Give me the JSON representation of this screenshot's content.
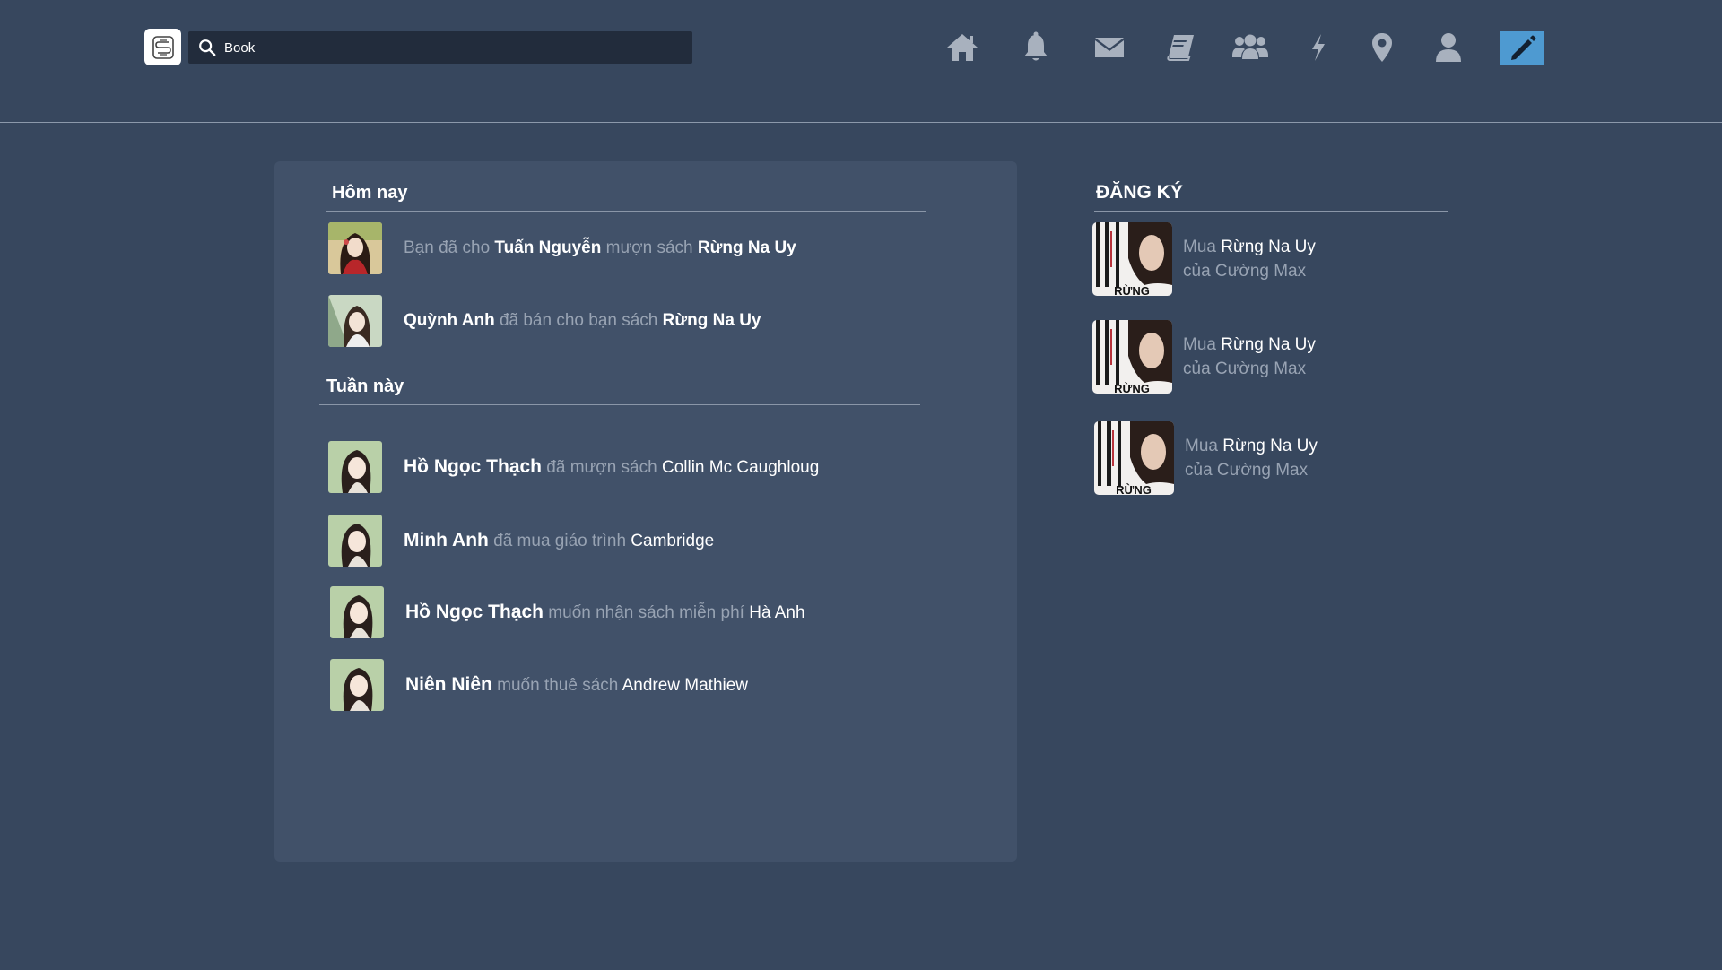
{
  "header": {
    "logo": "S",
    "search_value": "Book",
    "nav_icons": [
      "home-icon",
      "bell-icon",
      "mail-icon",
      "book-icon",
      "group-icon",
      "bolt-icon",
      "location-icon",
      "user-icon",
      "pencil-icon"
    ],
    "active_color": "#4e9ad1"
  },
  "today": {
    "title": "Hôm nay",
    "items": [
      {
        "pre": "Bạn đã cho",
        "name": "Tuấn Nguyễn",
        "mid": "mượn sách",
        "book": "Rừng Na Uy"
      },
      {
        "name": "Quỳnh Anh",
        "mid": "đã bán cho bạn sách",
        "book": "Rừng Na Uy"
      }
    ]
  },
  "week": {
    "title": "Tuần này",
    "items": [
      {
        "name": "Hồ Ngọc Thạch",
        "mid": "đã mượn sách",
        "book": "Collin Mc Caughloug"
      },
      {
        "name": "Minh Anh",
        "mid": "đã mua giáo trình",
        "book": "Cambridge"
      },
      {
        "name": "Hồ Ngọc Thạch",
        "mid": "muốn nhận sách miễn phí",
        "book": "Hà Anh"
      },
      {
        "name": "Niên Niên",
        "mid": "muốn thuê sách",
        "book": "Andrew Mathiew"
      }
    ]
  },
  "subscriptions": {
    "title": "ĐĂNG KÝ",
    "items": [
      {
        "action": "Mua",
        "book": "Rừng Na Uy",
        "by": "của Cường Max",
        "cover_text": "RỪNG"
      },
      {
        "action": "Mua",
        "book": "Rừng Na Uy",
        "by": "của Cường Max",
        "cover_text": "RỪNG"
      },
      {
        "action": "Mua",
        "book": "Rừng Na Uy",
        "by": "của Cường Max",
        "cover_text": "RỪNG"
      }
    ]
  }
}
